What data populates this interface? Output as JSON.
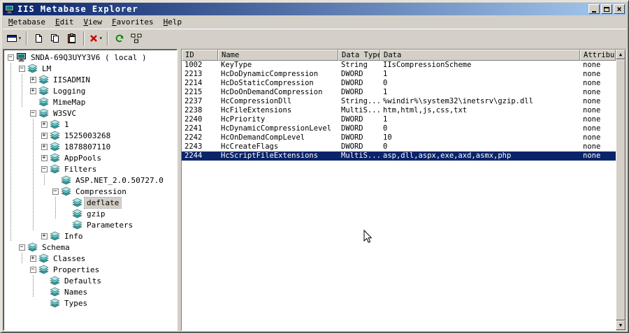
{
  "window": {
    "title": "IIS Metabase Explorer"
  },
  "menu": {
    "items": [
      {
        "label": "Metabase"
      },
      {
        "label": "Edit"
      },
      {
        "label": "View"
      },
      {
        "label": "Favorites"
      },
      {
        "label": "Help"
      }
    ]
  },
  "toolbar": {
    "buttons": [
      {
        "type": "button",
        "name": "navigate",
        "icon": "window-icon",
        "dropdown": true
      },
      {
        "type": "separator"
      },
      {
        "type": "button",
        "name": "new-key",
        "icon": "new-key-icon"
      },
      {
        "type": "button",
        "name": "copy",
        "icon": "copy-icon"
      },
      {
        "type": "button",
        "name": "paste",
        "icon": "paste-icon"
      },
      {
        "type": "separator"
      },
      {
        "type": "button",
        "name": "delete",
        "icon": "delete-icon",
        "dropdown": true
      },
      {
        "type": "separator"
      },
      {
        "type": "button",
        "name": "refresh",
        "icon": "refresh-icon"
      },
      {
        "type": "button",
        "name": "network",
        "icon": "network-icon"
      }
    ]
  },
  "tree": {
    "nodes": [
      {
        "label": "SNDA-69Q3UYY3V6 ( local )",
        "level": 0,
        "expander": "minus",
        "icon": "computer-icon",
        "selected": false
      },
      {
        "label": "LM",
        "level": 1,
        "expander": "minus",
        "icon": "key-icon",
        "selected": false
      },
      {
        "label": "IISADMIN",
        "level": 2,
        "expander": "plus",
        "icon": "key-icon",
        "selected": false
      },
      {
        "label": "Logging",
        "level": 2,
        "expander": "plus",
        "icon": "key-icon",
        "selected": false
      },
      {
        "label": "MimeMap",
        "level": 2,
        "expander": "none",
        "icon": "key-icon",
        "selected": false
      },
      {
        "label": "W3SVC",
        "level": 2,
        "expander": "minus",
        "icon": "key-icon",
        "selected": false
      },
      {
        "label": "1",
        "level": 3,
        "expander": "plus",
        "icon": "key-icon",
        "selected": false
      },
      {
        "label": "1525003268",
        "level": 3,
        "expander": "plus",
        "icon": "key-icon",
        "selected": false
      },
      {
        "label": "1878807110",
        "level": 3,
        "expander": "plus",
        "icon": "key-icon",
        "selected": false
      },
      {
        "label": "AppPools",
        "level": 3,
        "expander": "plus",
        "icon": "key-icon",
        "selected": false
      },
      {
        "label": "Filters",
        "level": 3,
        "expander": "minus",
        "icon": "key-icon",
        "selected": false
      },
      {
        "label": "ASP.NET_2.0.50727.0",
        "level": 4,
        "expander": "none",
        "icon": "key-icon",
        "selected": false
      },
      {
        "label": "Compression",
        "level": 4,
        "expander": "minus",
        "icon": "key-icon",
        "selected": false
      },
      {
        "label": "deflate",
        "level": 5,
        "expander": "none",
        "icon": "key-icon",
        "selected": true
      },
      {
        "label": "gzip",
        "level": 5,
        "expander": "none",
        "icon": "key-icon",
        "selected": false
      },
      {
        "label": "Parameters",
        "level": 5,
        "expander": "none",
        "icon": "key-icon",
        "selected": false
      },
      {
        "label": "Info",
        "level": 3,
        "expander": "plus",
        "icon": "key-icon",
        "selected": false
      },
      {
        "label": "Schema",
        "level": 1,
        "expander": "minus",
        "icon": "key-icon",
        "selected": false
      },
      {
        "label": "Classes",
        "level": 2,
        "expander": "plus",
        "icon": "key-icon",
        "selected": false
      },
      {
        "label": "Properties",
        "level": 2,
        "expander": "minus",
        "icon": "key-icon",
        "selected": false
      },
      {
        "label": "Defaults",
        "level": 3,
        "expander": "none",
        "icon": "key-icon",
        "selected": false
      },
      {
        "label": "Names",
        "level": 3,
        "expander": "none",
        "icon": "key-icon",
        "selected": false
      },
      {
        "label": "Types",
        "level": 3,
        "expander": "none",
        "icon": "key-icon",
        "selected": false
      }
    ]
  },
  "list": {
    "columns": [
      {
        "key": "id",
        "label": "ID"
      },
      {
        "key": "name",
        "label": "Name"
      },
      {
        "key": "data_type",
        "label": "Data Type"
      },
      {
        "key": "data",
        "label": "Data"
      },
      {
        "key": "attributes",
        "label": "Attributes"
      }
    ],
    "rows": [
      {
        "id": "1002",
        "name": "KeyType",
        "data_type": "String",
        "data": "IIsCompressionScheme",
        "attributes": "none",
        "selected": false
      },
      {
        "id": "2213",
        "name": "HcDoDynamicCompression",
        "data_type": "DWORD",
        "data": "1",
        "attributes": "none",
        "selected": false
      },
      {
        "id": "2214",
        "name": "HcDoStaticCompression",
        "data_type": "DWORD",
        "data": "0",
        "attributes": "none",
        "selected": false
      },
      {
        "id": "2215",
        "name": "HcDoOnDemandCompression",
        "data_type": "DWORD",
        "data": "1",
        "attributes": "none",
        "selected": false
      },
      {
        "id": "2237",
        "name": "HcCompressionDll",
        "data_type": "String...",
        "data": "%windir%\\system32\\inetsrv\\gzip.dll",
        "attributes": "none",
        "selected": false
      },
      {
        "id": "2238",
        "name": "HcFileExtensions",
        "data_type": "MultiS...",
        "data": "htm,html,js,css,txt",
        "attributes": "none",
        "selected": false
      },
      {
        "id": "2240",
        "name": "HcPriority",
        "data_type": "DWORD",
        "data": "1",
        "attributes": "none",
        "selected": false
      },
      {
        "id": "2241",
        "name": "HcDynamicCompressionLevel",
        "data_type": "DWORD",
        "data": "0",
        "attributes": "none",
        "selected": false
      },
      {
        "id": "2242",
        "name": "HcOnDemandCompLevel",
        "data_type": "DWORD",
        "data": "10",
        "attributes": "none",
        "selected": false
      },
      {
        "id": "2243",
        "name": "HcCreateFlags",
        "data_type": "DWORD",
        "data": "0",
        "attributes": "none",
        "selected": false
      },
      {
        "id": "2244",
        "name": "HcScriptFileExtensions",
        "data_type": "MultiS...",
        "data": "asp,dll,aspx,exe,axd,asmx,php",
        "attributes": "none",
        "selected": true
      }
    ]
  },
  "colors": {
    "chrome": "#d4d0c8",
    "title_gradient_start": "#0a246a",
    "title_gradient_end": "#a6caf0",
    "selection": "#0a246a",
    "tree_selection": "#d4d0c8"
  }
}
